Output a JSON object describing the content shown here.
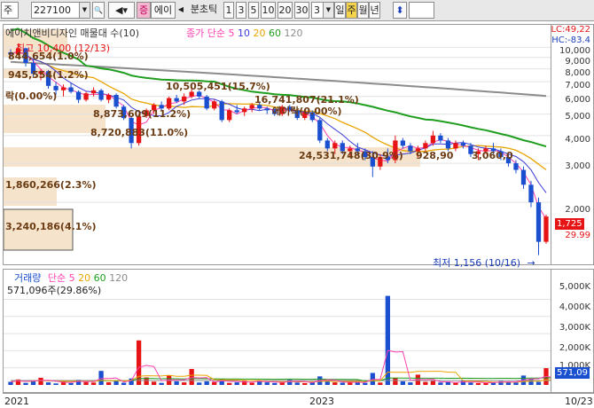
{
  "toolbar": {
    "market": "주",
    "code": "227100",
    "name_tab": "에이",
    "badge": "증",
    "period_prefix": "분초틱",
    "periods": [
      "1",
      "3",
      "5",
      "10",
      "20",
      "30"
    ],
    "count": "3",
    "day": "일",
    "week": "주",
    "month": "월",
    "year": "년"
  },
  "price_panel": {
    "stock_name": "에이치앤비디자인 매물대 수(10)",
    "ma_title": "종가 단순",
    "ma_periods": [
      "5",
      "10",
      "20",
      "60",
      "120"
    ],
    "lc_label": "LC:49,22",
    "hc_label": "HC:-83.4",
    "high_label": "최고 10,400 (12/13)",
    "low_label": "최저 1,156 (10/16)",
    "low_arrow": "→",
    "current_price": "1,725",
    "current_change": "29.99",
    "volume_profile": [
      "844,654(1.0%)",
      "945,554(1.2%)",
      "락(0.00%)",
      "10,505,451(15.7%)",
      "8,873,609(11.2%)",
      "16,741,807(21.1%)",
      "에이락(0.00%)",
      "8,720,883(11.0%)",
      "24,531,748(30.9%)",
      "928,90",
      "3,060,0",
      "1,860,266(2.3%)",
      "3,240,186(4.1%)"
    ],
    "yticks": [
      "10,000",
      "9,000",
      "8,000",
      "7,000",
      "6,000",
      "5,000",
      "4,000",
      "3,000",
      "2,000"
    ]
  },
  "volume_panel": {
    "title": "거래량",
    "ma_title": "단순",
    "ma_periods": [
      "5",
      "20",
      "60",
      "120"
    ],
    "current_volume": "571,096주(29.86%)",
    "current_box": "571,09",
    "yticks": [
      "5,000K",
      "4,000K",
      "3,000K",
      "2,000K",
      "1,000K"
    ]
  },
  "x_axis": {
    "labels": [
      "2021",
      "2023",
      "10/23"
    ]
  },
  "colors": {
    "ma5": "#ff3fb0",
    "ma10": "#3b3bd8",
    "ma20": "#e8a400",
    "ma60": "#1f9e1f",
    "ma120": "#8c8c8c",
    "up": "#e61414",
    "down": "#1a4fd0",
    "profile": "#f6e3cc"
  },
  "chart_data": {
    "type": "candlestick",
    "period": "weekly",
    "candles": [
      [
        9500,
        9800,
        9000,
        9300
      ],
      [
        9300,
        10400,
        9200,
        9900
      ],
      [
        9900,
        9950,
        8200,
        8500
      ],
      [
        8500,
        8800,
        7400,
        7600
      ],
      [
        7600,
        8000,
        7100,
        7800
      ],
      [
        7800,
        7900,
        6500,
        6700
      ],
      [
        6700,
        7000,
        6100,
        6400
      ],
      [
        6400,
        6800,
        6000,
        6600
      ],
      [
        6600,
        6900,
        6200,
        6300
      ],
      [
        6300,
        6400,
        5600,
        5800
      ],
      [
        5800,
        6300,
        5700,
        6200
      ],
      [
        6200,
        6600,
        6000,
        6400
      ],
      [
        6400,
        6500,
        5700,
        5800
      ],
      [
        5800,
        6200,
        5600,
        6100
      ],
      [
        6100,
        6200,
        5300,
        5400
      ],
      [
        5400,
        5500,
        4700,
        4800
      ],
      [
        4800,
        4900,
        3500,
        3700
      ],
      [
        3700,
        5000,
        3600,
        4900
      ],
      [
        4900,
        5300,
        4800,
        5200
      ],
      [
        5200,
        5600,
        5000,
        5500
      ],
      [
        5500,
        5700,
        5200,
        5300
      ],
      [
        5300,
        6000,
        5200,
        5900
      ],
      [
        5900,
        6100,
        5600,
        5700
      ],
      [
        5700,
        6200,
        5500,
        6000
      ],
      [
        6000,
        6500,
        5900,
        6300
      ],
      [
        6300,
        6400,
        5900,
        6000
      ],
      [
        6000,
        6100,
        5200,
        5300
      ],
      [
        5300,
        5800,
        5200,
        5700
      ],
      [
        5700,
        5800,
        4600,
        4700
      ],
      [
        4700,
        5300,
        4600,
        5200
      ],
      [
        5200,
        5500,
        5000,
        5100
      ],
      [
        5100,
        5400,
        4900,
        5300
      ],
      [
        5300,
        5600,
        5100,
        5500
      ],
      [
        5500,
        5700,
        5200,
        5300
      ],
      [
        5300,
        5400,
        5000,
        5200
      ],
      [
        5200,
        5300,
        4900,
        5000
      ],
      [
        5000,
        5500,
        4900,
        5400
      ],
      [
        5400,
        5500,
        5100,
        5200
      ],
      [
        5200,
        5300,
        4700,
        4800
      ],
      [
        4800,
        5200,
        4700,
        5100
      ],
      [
        5100,
        5200,
        4600,
        4700
      ],
      [
        4700,
        4800,
        3700,
        3800
      ],
      [
        3800,
        3900,
        3400,
        3500
      ],
      [
        3500,
        3800,
        3300,
        3700
      ],
      [
        3700,
        3800,
        3300,
        3400
      ],
      [
        3400,
        3600,
        3200,
        3500
      ],
      [
        3500,
        3700,
        3300,
        3400
      ],
      [
        3400,
        3500,
        3100,
        3200
      ],
      [
        3200,
        3400,
        2600,
        2900
      ],
      [
        2900,
        3300,
        2800,
        3200
      ],
      [
        3200,
        3500,
        3000,
        3100
      ],
      [
        3100,
        4000,
        3000,
        3800
      ],
      [
        3800,
        3900,
        3500,
        3600
      ],
      [
        3600,
        3700,
        3300,
        3400
      ],
      [
        3400,
        3600,
        3200,
        3500
      ],
      [
        3500,
        3800,
        3400,
        3700
      ],
      [
        3700,
        4200,
        3600,
        4000
      ],
      [
        4000,
        4100,
        3700,
        3800
      ],
      [
        3800,
        3900,
        3400,
        3500
      ],
      [
        3500,
        3800,
        3400,
        3700
      ],
      [
        3700,
        3800,
        3500,
        3600
      ],
      [
        3600,
        3700,
        3200,
        3300
      ],
      [
        3300,
        3500,
        3100,
        3400
      ],
      [
        3400,
        3600,
        3300,
        3500
      ],
      [
        3500,
        3700,
        3300,
        3400
      ],
      [
        3400,
        3500,
        3100,
        3200
      ],
      [
        3200,
        3300,
        2900,
        3000
      ],
      [
        3000,
        3100,
        2700,
        2800
      ],
      [
        2800,
        2900,
        2300,
        2400
      ],
      [
        2400,
        2500,
        1900,
        2000
      ],
      [
        2000,
        2100,
        1156,
        1327
      ],
      [
        1327,
        1760,
        1300,
        1725
      ]
    ],
    "volumes_k": [
      180,
      320,
      120,
      260,
      420,
      150,
      90,
      230,
      110,
      300,
      170,
      140,
      820,
      160,
      240,
      130,
      380,
      2600,
      440,
      190,
      120,
      560,
      210,
      150,
      930,
      140,
      210,
      170,
      340,
      120,
      150,
      230,
      130,
      280,
      150,
      120,
      170,
      320,
      140,
      110,
      160,
      500,
      220,
      150,
      130,
      180,
      150,
      120,
      700,
      140,
      5200,
      420,
      210,
      150,
      600,
      180,
      230,
      140,
      170,
      120,
      250,
      140,
      110,
      130,
      160,
      220,
      170,
      140,
      550,
      360,
      180,
      980,
      120,
      571
    ]
  }
}
